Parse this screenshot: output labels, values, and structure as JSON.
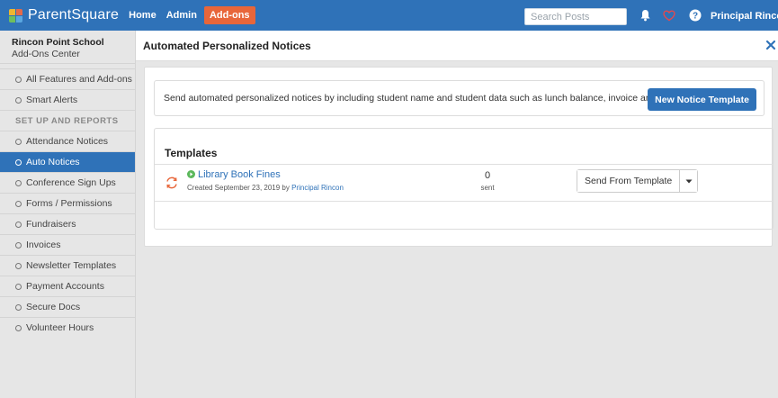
{
  "topbar": {
    "app_name": "ParentSquare",
    "nav": [
      "Home",
      "Admin",
      "Add-ons"
    ],
    "search_placeholder": "Search Posts",
    "user": "Principal Rincon ▾",
    "colors": {
      "bar": "#2f72b8",
      "active_nav": "#e8663a",
      "heart": "#e5484d"
    },
    "icons": [
      "bell-icon",
      "heart-icon",
      "help-icon"
    ]
  },
  "sidebar": {
    "school_name": "Rincon Point School",
    "school_sub": "Add-Ons Center",
    "top_items": [
      "All Features and Add-ons",
      "Smart Alerts"
    ],
    "section_heading": "SET UP AND REPORTS",
    "items": [
      "Attendance Notices",
      "Auto Notices",
      "Conference Sign Ups",
      "Forms / Permissions",
      "Fundraisers",
      "Invoices",
      "Newsletter Templates",
      "Payment Accounts",
      "Secure Docs",
      "Volunteer Hours"
    ],
    "active_item": "Auto Notices"
  },
  "main": {
    "page_title": "Automated Personalized Notices",
    "intro": "Send automated personalized notices by including student name and student data such as lunch balance, invoice amount etc.",
    "new_template_label": "New Notice Template",
    "templates_title": "Templates",
    "templates": [
      {
        "name": "Library Book Fines",
        "created_prefix": "Created September 23, 2019 by",
        "author": "Principal Rincon",
        "sent_count": "0",
        "sent_label": "sent",
        "action_label": "Send From Template"
      }
    ]
  }
}
